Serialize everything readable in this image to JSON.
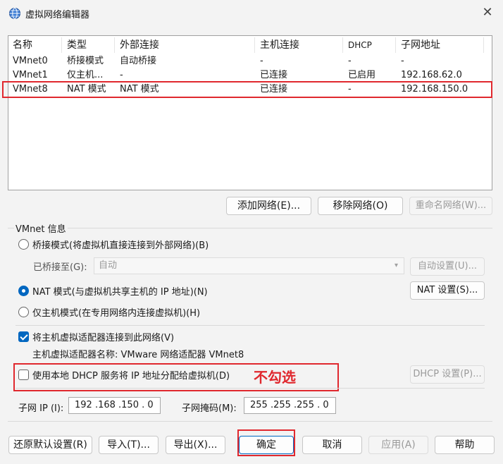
{
  "window": {
    "title": "虚拟网络编辑器",
    "icon": "globe-network-icon",
    "close": "✕"
  },
  "table": {
    "headers": [
      "名称",
      "类型",
      "外部连接",
      "主机连接",
      "DHCP",
      "子网地址"
    ],
    "rows": [
      [
        "VMnet0",
        "桥接模式",
        "自动桥接",
        "-",
        "-",
        "-"
      ],
      [
        "VMnet1",
        "仅主机...",
        "-",
        "已连接",
        "已启用",
        "192.168.62.0"
      ],
      [
        "VMnet8",
        "NAT 模式",
        "NAT 模式",
        "已连接",
        "-",
        "192.168.150.0"
      ]
    ]
  },
  "table_buttons": {
    "add": "添加网络(E)...",
    "remove": "移除网络(O)",
    "rename": "重命名网络(W)..."
  },
  "info": {
    "group_title": "VMnet 信息",
    "bridge_radio": "桥接模式(将虚拟机直接连接到外部网络)(B)",
    "bridged_to_label": "已桥接至(G):",
    "bridged_to_value": "自动",
    "auto_settings": "自动设置(U)...",
    "nat_radio": "NAT 模式(与虚拟机共享主机的 IP 地址)(N)",
    "nat_settings": "NAT 设置(S)...",
    "host_only_radio": "仅主机模式(在专用网络内连接虚拟机)(H)",
    "connect_adapter": "将主机虚拟适配器连接到此网络(V)",
    "adapter_name": "主机虚拟适配器名称: VMware 网络适配器 VMnet8",
    "use_dhcp": "使用本地 DHCP 服务将 IP 地址分配给虚拟机(D)",
    "dhcp_settings": "DHCP 设置(P)...",
    "annotation": "不勾选",
    "subnet_ip_label": "子网 IP (I):",
    "subnet_ip_value": "192 .168 .150 . 0",
    "subnet_mask_label": "子网掩码(M):",
    "subnet_mask_value": "255 .255 .255 . 0"
  },
  "footer": {
    "restore": "还原默认设置(R)",
    "import": "导入(T)...",
    "export": "导出(X)...",
    "ok": "确定",
    "cancel": "取消",
    "apply": "应用(A)",
    "help": "帮助"
  },
  "colors": {
    "accent": "#0067c0",
    "annotation_red": "#e0282e"
  }
}
